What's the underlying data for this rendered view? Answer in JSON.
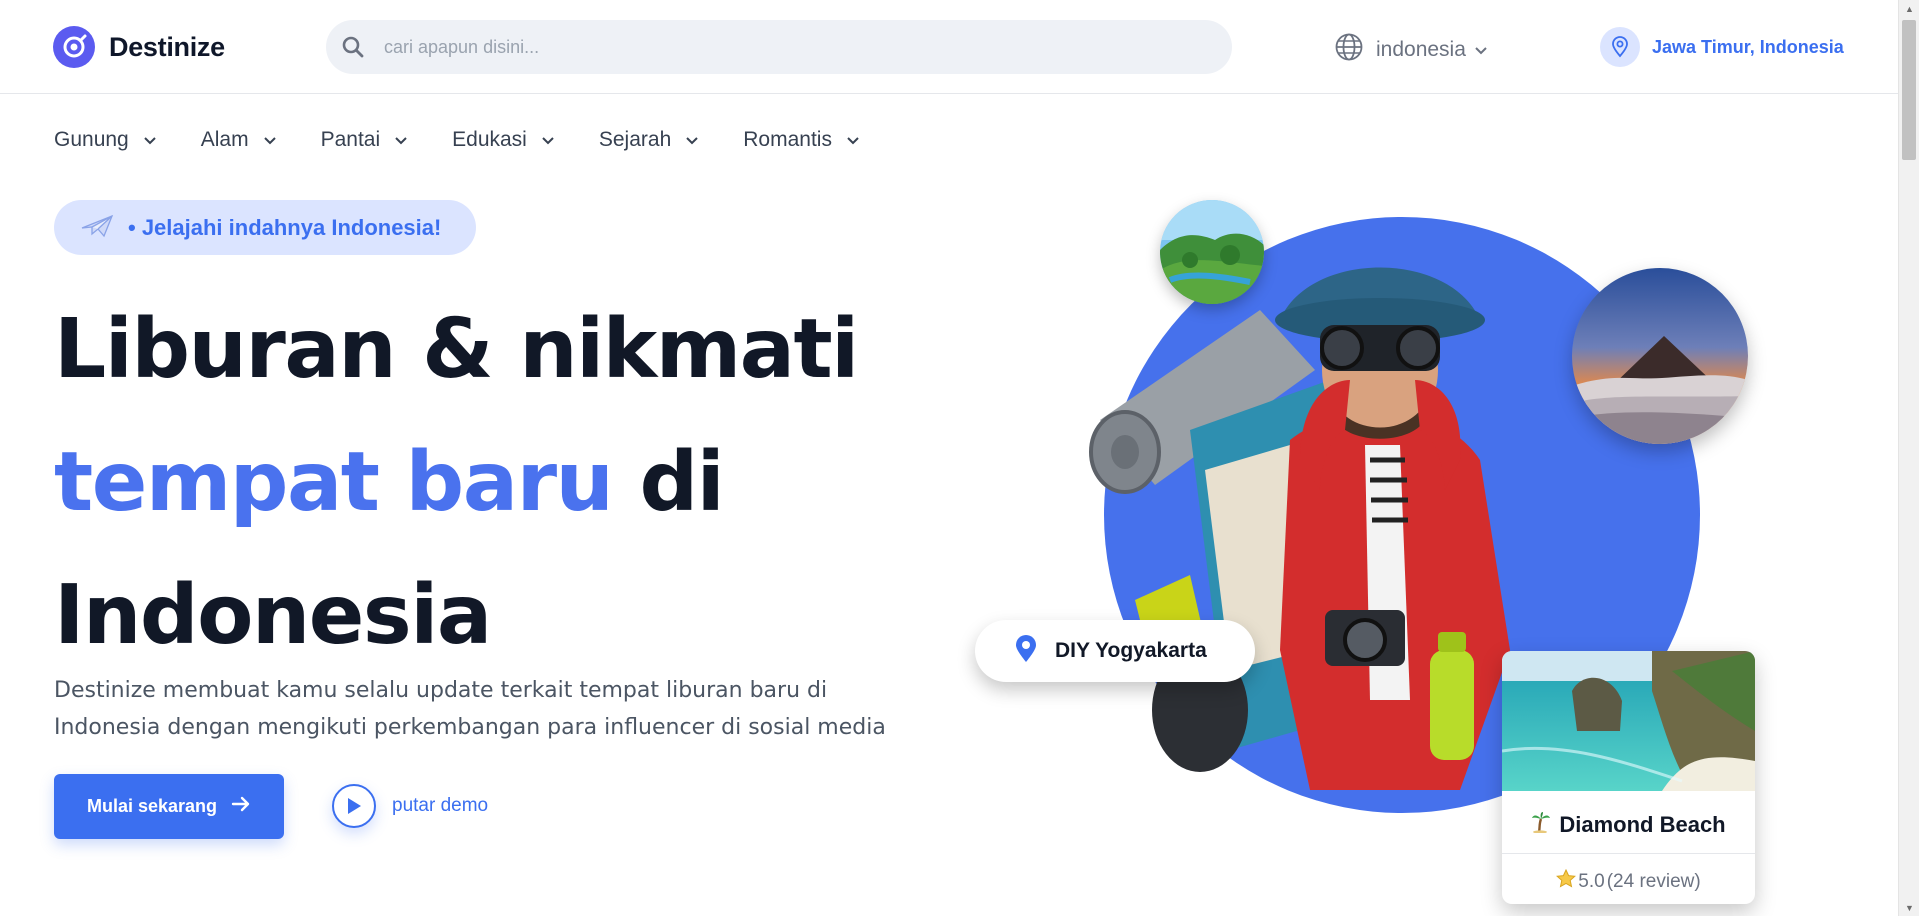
{
  "header": {
    "brand": "Destinize",
    "search_placeholder": "cari apapun disini...",
    "language": "indonesia",
    "location": "Jawa Timur, Indonesia"
  },
  "categories": [
    {
      "label": "Gunung"
    },
    {
      "label": "Alam"
    },
    {
      "label": "Pantai"
    },
    {
      "label": "Edukasi"
    },
    {
      "label": "Sejarah"
    },
    {
      "label": "Romantis"
    }
  ],
  "hero": {
    "tagline": "• Jelajahi indahnya Indonesia!",
    "headline_line1": "Liburan & nikmati",
    "headline_highlight": "tempat baru",
    "headline_after_highlight": " di",
    "headline_line3": "Indonesia",
    "description_line1": "Destinize membuat kamu selalu update terkait tempat liburan baru di",
    "description_line2": "Indonesia dengan mengikuti perkembangan para influencer di sosial media",
    "cta_primary": "Mulai sekarang",
    "cta_demo": "putar demo"
  },
  "featured": {
    "location_label": "DIY Yogyakarta",
    "place_name": "Diamond Beach",
    "rating": "5.0",
    "reviews": "(24 review)"
  },
  "colors": {
    "accent": "#3b6ff0",
    "hero_circle": "#4671ec",
    "pill_bg": "#dbe4ff",
    "heading": "#111827"
  }
}
